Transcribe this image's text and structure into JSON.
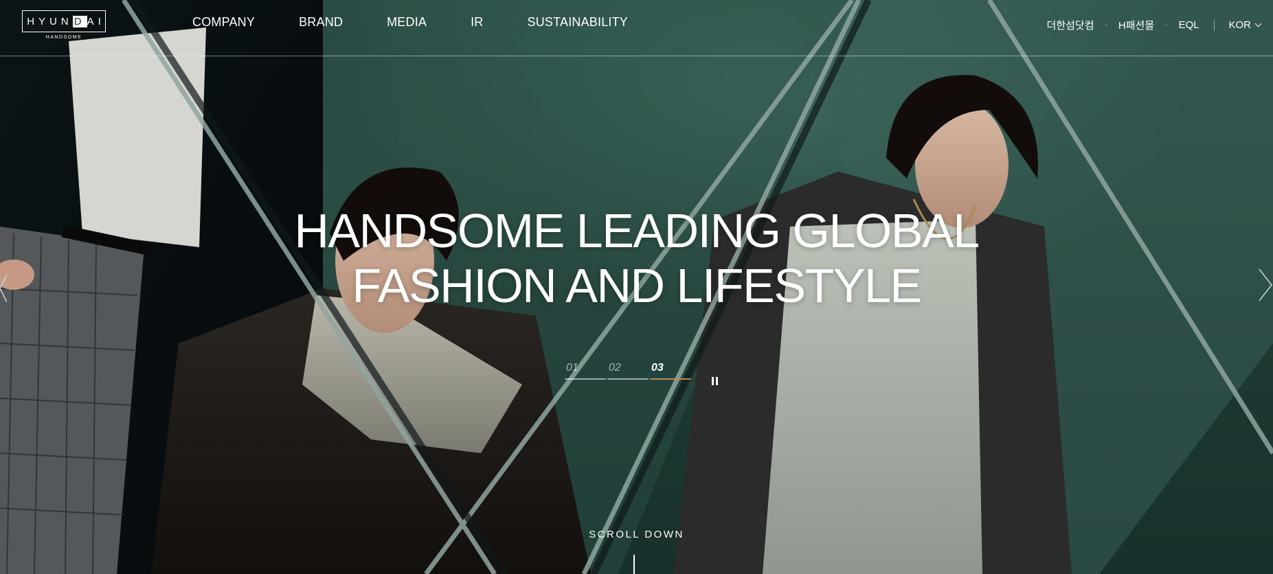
{
  "header": {
    "logo": {
      "wordmark_left": "HYUN",
      "wordmark_inverted": "D",
      "wordmark_right": "AI",
      "subtitle": "HANDSOME"
    },
    "nav": [
      "COMPANY",
      "BRAND",
      "MEDIA",
      "IR",
      "SUSTAINABILITY"
    ],
    "utility_links": [
      "더한섬닷컴",
      "H패션몰",
      "EQL"
    ],
    "separator_dot": "·",
    "language": "KOR"
  },
  "hero": {
    "headline_line1": "HANDSOME LEADING GLOBAL",
    "headline_line2": "FASHION AND LIFESTYLE",
    "slides": [
      "01",
      "02",
      "03"
    ],
    "active_slide": "03",
    "scroll_label": "SCROLL DOWN"
  },
  "colors": {
    "background": "#1e3a35",
    "active_bar": "#c08a55",
    "text": "#ffffff"
  },
  "icons": [
    "pause-icon",
    "chevron-down-icon",
    "arrow-right-icon",
    "arrow-left-icon"
  ]
}
